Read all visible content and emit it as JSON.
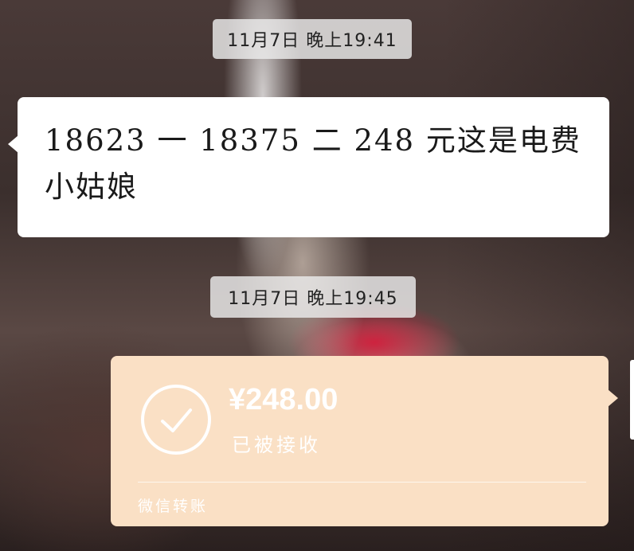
{
  "timestamps": [
    "11月7日 晚上19:41",
    "11月7日 晚上19:45"
  ],
  "messages": [
    {
      "direction": "incoming",
      "text": "18623 一 18375 二 248 元这是电费小姑娘"
    }
  ],
  "transfer": {
    "direction": "outgoing",
    "amount": "¥248.00",
    "status": "已被接收",
    "footer": "微信转账",
    "icon": "check-circle-icon",
    "color": "#fae0c5"
  }
}
